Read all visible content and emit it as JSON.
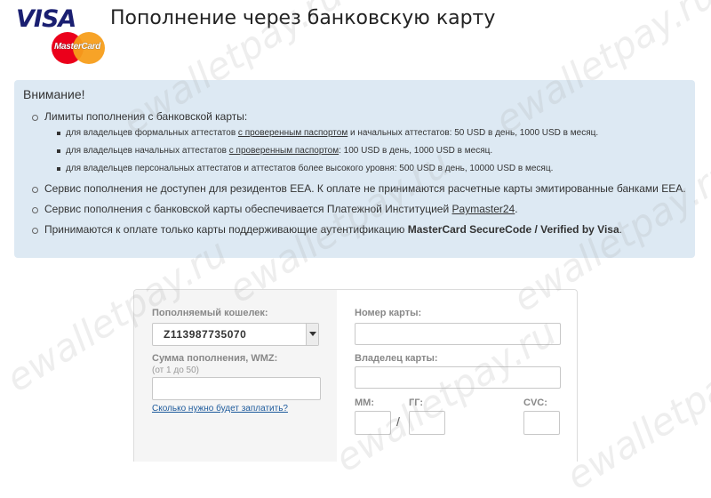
{
  "header": {
    "visa_logo": "VISA",
    "mastercard_logo": "MasterCard",
    "title": "Пополнение через банковскую карту"
  },
  "notice": {
    "title": "Внимание!",
    "limits_heading": "Лимиты пополнения с банковской карты:",
    "limits": [
      {
        "pre": "для владельцев формальных аттестатов ",
        "link": "с проверенным паспортом",
        "post": " и начальных аттестатов: 50 USD в день, 1000 USD в месяц."
      },
      {
        "pre": "для владельцев начальных аттестатов ",
        "link": "с проверенным паспортом",
        "post": ": 100 USD в день, 1000 USD в месяц."
      },
      {
        "pre": "для владельцев персональных аттестатов и аттестатов более высокого уровня: 500 USD в день, 10000 USD в месяц.",
        "link": "",
        "post": ""
      }
    ],
    "eea_text": "Сервис пополнения не доступен для резидентов EEA. К оплате не принимаются расчетные карты эмитированные банками EEA.",
    "provider_pre": "Сервис пополнения с банковской карты обеспечивается Платежной Институцией ",
    "provider_link": "Paymaster24",
    "provider_post": ".",
    "secure_pre": "Принимаются к оплате только карты поддерживающие аутентификацию ",
    "secure_bold": "MasterCard SecureCode / Verified by Visa",
    "secure_post": "."
  },
  "form": {
    "wallet_label": "Пополняемый кошелек:",
    "wallet_value": "Z113987735070",
    "amount_label": "Сумма пополнения, WMZ:",
    "amount_hint": "(от 1 до 50)",
    "amount_value": "",
    "pay_link": "Сколько нужно будет заплатить?",
    "card_number_label": "Номер карты:",
    "card_number_value": "",
    "card_holder_label": "Владелец карты:",
    "card_holder_value": "",
    "mm_label": "ММ:",
    "yy_label": "ГГ:",
    "cvc_label": "CVC:",
    "slash": "/"
  },
  "watermark": "ewalletpay.ru",
  "colors": {
    "notice_bg": "#dde9f3",
    "visa_blue": "#1a1f71",
    "link_blue": "#1d5a9c"
  }
}
